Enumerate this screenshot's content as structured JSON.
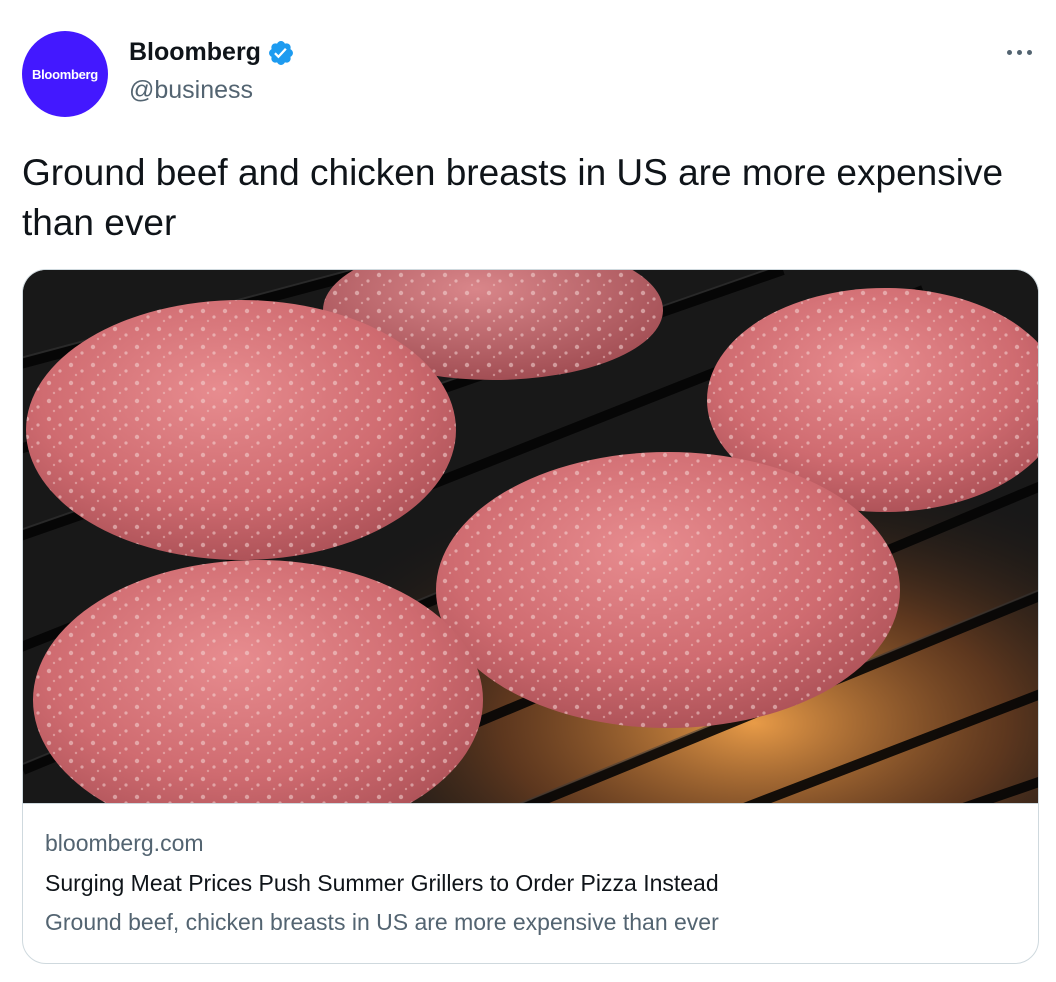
{
  "author": {
    "display_name": "Bloomberg",
    "handle": "@business",
    "avatar_text": "Bloomberg",
    "verified": true,
    "avatar_color": "#4318ff",
    "verified_color": "#1d9bf0"
  },
  "tweet": {
    "text": "Ground beef and chicken breasts in US are more expensive than ever"
  },
  "card": {
    "image_icon": "grilling-burger-patties-photo",
    "domain": "bloomberg.com",
    "title": "Surging Meat Prices Push Summer Grillers to Order Pizza Instead",
    "description": "Ground beef, chicken breasts in US are more expensive than ever"
  },
  "icons": {
    "more": "more-options-icon",
    "verified": "verified-badge-icon"
  }
}
